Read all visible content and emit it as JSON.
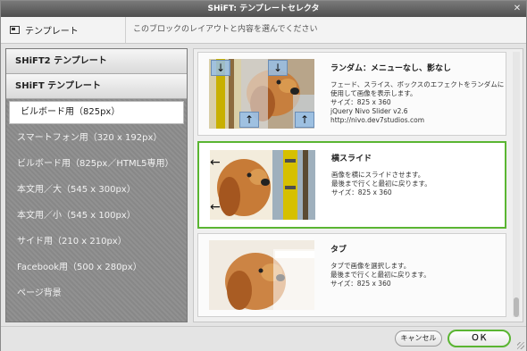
{
  "window": {
    "title": "SHiFT: テンプレートセレクタ",
    "close_label": "✕"
  },
  "header": {
    "title": "テンプレート",
    "description": "このブロックのレイアウトと内容を選んでください"
  },
  "sidebar": {
    "categories": [
      "SHiFT2 テンプレート",
      "SHiFT テンプレート"
    ],
    "items": [
      {
        "label": "ビルボード用（825px）",
        "selected": true
      },
      {
        "label": "スマートフォン用（320 x 192px）",
        "selected": false
      },
      {
        "label": "ビルボード用（825px／HTML5専用）",
        "selected": false
      },
      {
        "label": "本文用／大（545 x 300px）",
        "selected": false
      },
      {
        "label": "本文用／小（545 x 100px）",
        "selected": false
      },
      {
        "label": "サイド用（210 x 210px）",
        "selected": false
      },
      {
        "label": "Facebook用（500 x 280px）",
        "selected": false
      },
      {
        "label": "ページ背景",
        "selected": false
      }
    ]
  },
  "templates": [
    {
      "name": "ランダム：メニューなし、影なし",
      "description": "フェード、スライス、ボックスのエフェクトをランダムに\n使用して画像を表示します。\nサイズ：825 x 360\njQuery Nivo Slider v2.6\nhttp://nivo.dev7studios.com",
      "selected": false,
      "icon": "random-effect-thumbnail"
    },
    {
      "name": "横スライド",
      "description": "画像を横にスライドさせます。\n最後まで行くと最初に戻ります。\nサイズ：825 x 360",
      "selected": true,
      "icon": "horizontal-slide-thumbnail"
    },
    {
      "name": "タブ",
      "description": "タブで画像を選択します。\n最後まで行くと最初に戻ります。\nサイズ：825 x 360",
      "selected": false,
      "icon": "tab-thumbnail"
    }
  ],
  "footer": {
    "cancel_label": "キャンセル",
    "ok_label": "ＯＫ"
  },
  "colors": {
    "accent": "#5ab532",
    "titlebar": "#5a5a5a",
    "sidebar_bg": "#8d8d8d"
  }
}
